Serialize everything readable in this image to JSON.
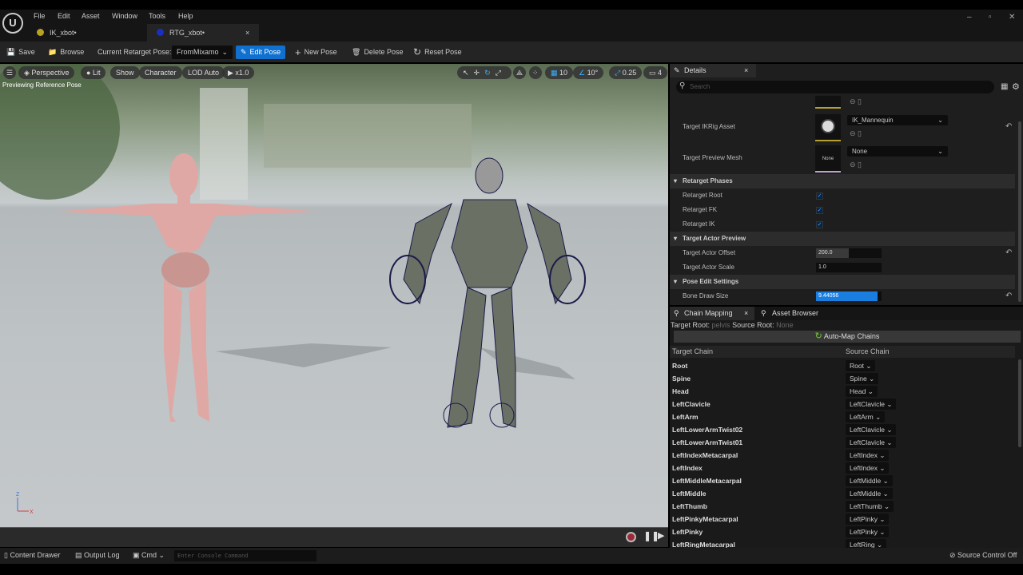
{
  "menu": {
    "items": [
      "File",
      "Edit",
      "Asset",
      "Window",
      "Tools",
      "Help"
    ]
  },
  "tabs": [
    {
      "label": "IK_xbot•"
    },
    {
      "label": "RTG_xbot•",
      "close": "×"
    }
  ],
  "toolbar": {
    "save": "Save",
    "browse": "Browse",
    "pose_label": "Current Retarget Pose:",
    "pose_value": "FromMixamo",
    "edit_pose": "Edit Pose",
    "new_pose": "New Pose",
    "delete_pose": "Delete Pose",
    "reset_pose": "Reset Pose"
  },
  "viewport": {
    "perspective": "Perspective",
    "lit": "Lit",
    "show": "Show",
    "character": "Character",
    "lod": "LOD Auto",
    "speed": "x1.0",
    "status": "Previewing Reference Pose",
    "grid_snap": "10",
    "rot_snap": "10°",
    "scale_snap": "0.25",
    "camera_speed": "4"
  },
  "details": {
    "tab": "Details",
    "close": "×",
    "search_placeholder": "Search",
    "target_ikrig_label": "Target IKRig Asset",
    "target_ikrig_value": "IK_Mannequin",
    "target_mesh_label": "Target Preview Mesh",
    "target_mesh_value": "None",
    "thumb_none": "None",
    "sections": {
      "phases": "Retarget Phases",
      "actor": "Target Actor Preview",
      "pose": "Pose Edit Settings"
    },
    "retarget_root": "Retarget Root",
    "retarget_fk": "Retarget FK",
    "retarget_ik": "Retarget IK",
    "offset_label": "Target Actor Offset",
    "offset_value": "200.0",
    "scale_label": "Target Actor Scale",
    "scale_value": "1.0",
    "bone_label": "Bone Draw Size",
    "bone_value": "9.44056"
  },
  "chain": {
    "tab": "Chain Mapping",
    "close": "×",
    "asset_tab": "Asset Browser",
    "target_root_label": "Target Root:",
    "target_root": "pelvis",
    "source_root_label": "Source Root:",
    "source_root": "None",
    "automap": "Auto-Map Chains",
    "col_target": "Target Chain",
    "col_source": "Source Chain",
    "rows": [
      {
        "t": "Root",
        "s": "Root"
      },
      {
        "t": "Spine",
        "s": "Spine"
      },
      {
        "t": "Head",
        "s": "Head"
      },
      {
        "t": "LeftClavicle",
        "s": "LeftClavicle"
      },
      {
        "t": "LeftArm",
        "s": "LeftArm"
      },
      {
        "t": "LeftLowerArmTwist02",
        "s": "LeftClavicle"
      },
      {
        "t": "LeftLowerArmTwist01",
        "s": "LeftClavicle"
      },
      {
        "t": "LeftIndexMetacarpal",
        "s": "LeftIndex"
      },
      {
        "t": "LeftIndex",
        "s": "LeftIndex"
      },
      {
        "t": "LeftMiddleMetacarpal",
        "s": "LeftMiddle"
      },
      {
        "t": "LeftMiddle",
        "s": "LeftMiddle"
      },
      {
        "t": "LeftThumb",
        "s": "LeftThumb"
      },
      {
        "t": "LeftPinkyMetacarpal",
        "s": "LeftPinky"
      },
      {
        "t": "LeftPinky",
        "s": "LeftPinky"
      },
      {
        "t": "LeftRingMetacarpal",
        "s": "LeftRing"
      }
    ]
  },
  "statusbar": {
    "content_drawer": "Content Drawer",
    "output_log": "Output Log",
    "cmd": "Cmd",
    "console_placeholder": "Enter Console Command",
    "source_control": "Source Control Off"
  }
}
